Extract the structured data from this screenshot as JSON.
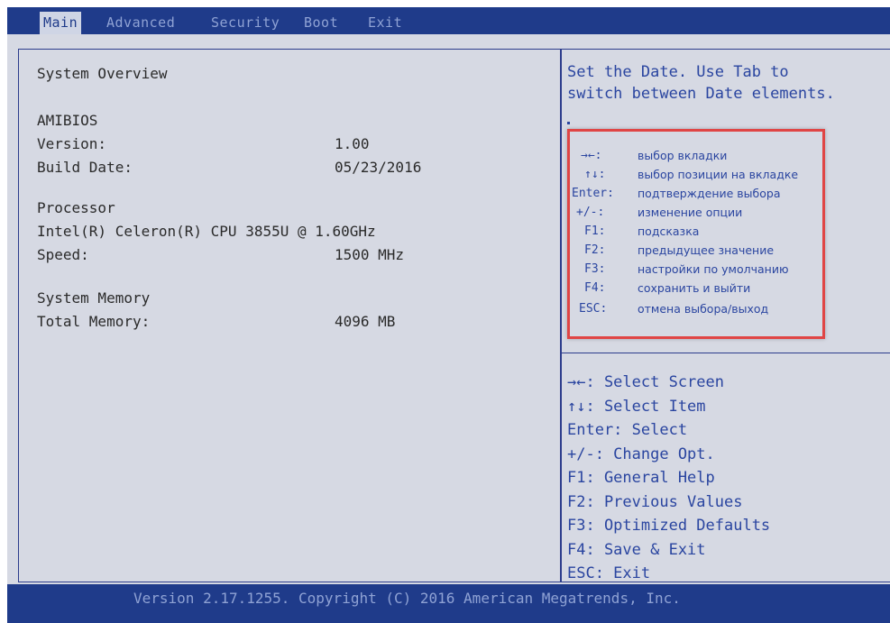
{
  "tabs": [
    "Main",
    "Advanced",
    "Security",
    "Boot",
    "Exit"
  ],
  "overview": {
    "heading": "System Overview",
    "bios_label": "AMIBIOS",
    "version_label": "Version:",
    "version_value": "1.00",
    "build_label": "Build Date:",
    "build_value": "05/23/2016",
    "processor_label": "Processor",
    "cpu_name": "Intel(R) Celeron(R) CPU 3855U @ 1.60GHz",
    "speed_label": "Speed:",
    "speed_value": "1500 MHz",
    "memory_label": "System Memory",
    "total_memory_label": "Total Memory:",
    "total_memory_value": "4096 MB"
  },
  "help": {
    "line1": "Set the Date. Use Tab to",
    "line2": "switch between Date elements."
  },
  "translation": [
    {
      "key": "→←:",
      "desc": "выбор вкладки"
    },
    {
      "key": "↑↓:",
      "desc": "выбор позиции на вкладке"
    },
    {
      "key": "Enter:",
      "desc": "подтверждение выбора"
    },
    {
      "key": "+/-:",
      "desc": "изменение опции"
    },
    {
      "key": "F1:",
      "desc": "подсказка"
    },
    {
      "key": "F2:",
      "desc": "предыдущее значение"
    },
    {
      "key": "F3:",
      "desc": "настройки по умолчанию"
    },
    {
      "key": "F4:",
      "desc": "сохранить и выйти"
    },
    {
      "key": "ESC:",
      "desc": "отмена выбора/выход"
    }
  ],
  "keys": [
    "→←: Select Screen",
    "↑↓: Select Item",
    "Enter: Select",
    "+/-: Change Opt.",
    "F1: General Help",
    "F2: Previous Values",
    "F3: Optimized Defaults",
    "F4: Save & Exit",
    "ESC: Exit"
  ],
  "footer": "Version 2.17.1255. Copyright (C) 2016 American Megatrends, Inc."
}
